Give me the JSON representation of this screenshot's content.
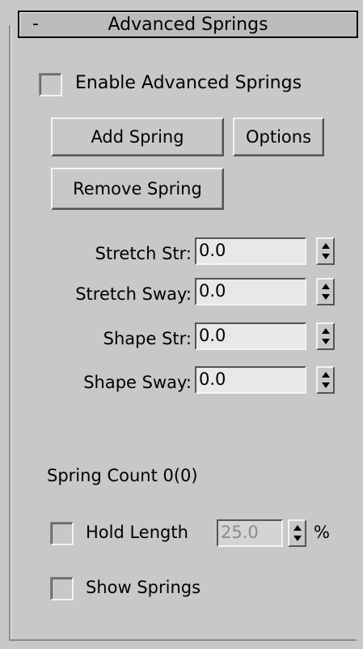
{
  "rollout": {
    "collapse_symbol": "-",
    "title": "Advanced Springs"
  },
  "enable_checkbox": {
    "label": "Enable Advanced Springs",
    "checked": false
  },
  "buttons": {
    "add_spring": "Add Spring",
    "options": "Options",
    "remove_spring": "Remove Spring"
  },
  "params": [
    {
      "label": "Stretch Str:",
      "value": "0.0"
    },
    {
      "label": "Stretch Sway:",
      "value": "0.0"
    },
    {
      "label": "Shape Str:",
      "value": "0.0"
    },
    {
      "label": "Shape Sway:",
      "value": "0.0"
    }
  ],
  "spring_count": "Spring Count 0(0)",
  "hold_length": {
    "label": "Hold Length",
    "value": "25.0",
    "unit": "%",
    "checked": false,
    "enabled": false
  },
  "show_springs": {
    "label": "Show Springs",
    "checked": false
  }
}
